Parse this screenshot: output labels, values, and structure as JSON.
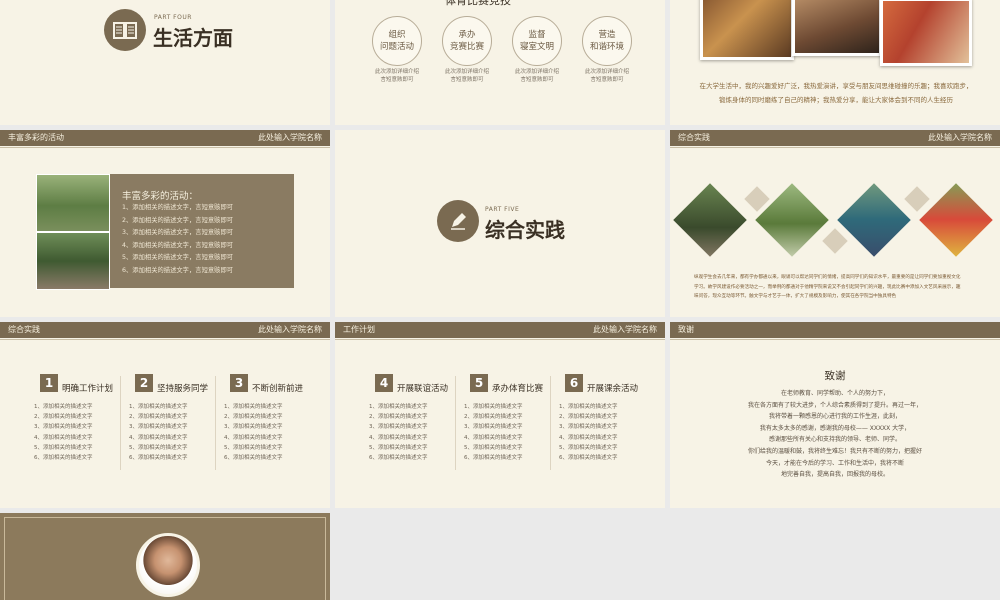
{
  "slide1": {
    "part": "PART FOUR",
    "title": "生活方面"
  },
  "slide2": {
    "top_title": "体育比赛竞技",
    "circles": [
      {
        "label": "组织\n问题活动",
        "desc": "此次添加详细介绍\n言短意赅即可"
      },
      {
        "label": "承办\n竞赛比赛",
        "desc": "此次添加详细介绍\n言短意赅即可"
      },
      {
        "label": "监督\n寝室文明",
        "desc": "此次添加详细介绍\n言短意赅即可"
      },
      {
        "label": "营造\n和谐环境",
        "desc": "此次添加详细介绍\n言短意赅即可"
      }
    ]
  },
  "slide3": {
    "para": "在大学生活中，我的兴趣爱好广泛，我热爱演讲，享受与朋友间思维碰撞的乐趣；我喜欢跑步，\n锻炼身体的同时磨练了自己的精神；我热爱分享，能让大家体会到不同的人生经历"
  },
  "slide4": {
    "header_left": "丰富多彩的活动",
    "header_right": "此处输入学院名称",
    "box_title": "丰富多彩的活动：",
    "items": [
      "1、添加相关的描述文字，言短意赅即可",
      "2、添加相关的描述文字，言短意赅即可",
      "3、添加相关的描述文字，言短意赅即可",
      "4、添加相关的描述文字，言短意赅即可",
      "5、添加相关的描述文字，言短意赅即可",
      "6、添加相关的描述文字，言短意赅即可"
    ]
  },
  "slide5": {
    "part": "PART FIVE",
    "title": "综合实践"
  },
  "slide6": {
    "header_left": "综合实践",
    "header_right": "此处输入学院名称",
    "para": "纵观学生会去几年来，都有学办都通以来，眼诵可以帮达同学们的情绪，提高同学们的知识水平，最重要的是让同学们要加重视文化\n学习。故学风建设作必要活动之一，而举例的都通对于他精学院来说又不会引起同学们的兴趣，现此比赛中添加入文艺风采展示，趣\n味问答，现众互动等环节。触文学与才艺于一体，扩大了规模及影响力，使其在各学院当中独具特色"
  },
  "columns_a": {
    "header_left": "综合实践",
    "header_right": "此处输入学院名称",
    "cols": [
      {
        "num": "1",
        "title": "明确工作计划",
        "items": [
          "1、添加相关的描述文字",
          "2、添加相关的描述文字",
          "3、添加相关的描述文字",
          "4、添加相关的描述文字",
          "5、添加相关的描述文字",
          "6、添加相关的描述文字"
        ]
      },
      {
        "num": "2",
        "title": "坚持服务同学",
        "items": [
          "1、添加相关的描述文字",
          "2、添加相关的描述文字",
          "3、添加相关的描述文字",
          "4、添加相关的描述文字",
          "5、添加相关的描述文字",
          "6、添加相关的描述文字"
        ]
      },
      {
        "num": "3",
        "title": "不断创新前进",
        "items": [
          "1、添加相关的描述文字",
          "2、添加相关的描述文字",
          "3、添加相关的描述文字",
          "4、添加相关的描述文字",
          "5、添加相关的描述文字",
          "6、添加相关的描述文字"
        ]
      }
    ]
  },
  "columns_b": {
    "header_left": "工作计划",
    "header_right": "此处输入学院名称",
    "cols": [
      {
        "num": "4",
        "title": "开展联谊活动",
        "items": [
          "1、添加相关的描述文字",
          "2、添加相关的描述文字",
          "3、添加相关的描述文字",
          "4、添加相关的描述文字",
          "5、添加相关的描述文字",
          "6、添加相关的描述文字"
        ]
      },
      {
        "num": "5",
        "title": "承办体育比赛",
        "items": [
          "1、添加相关的描述文字",
          "2、添加相关的描述文字",
          "3、添加相关的描述文字",
          "4、添加相关的描述文字",
          "5、添加相关的描述文字",
          "6、添加相关的描述文字"
        ]
      },
      {
        "num": "6",
        "title": "开展课余活动",
        "items": [
          "1、添加相关的描述文字",
          "2、添加相关的描述文字",
          "3、添加相关的描述文字",
          "4、添加相关的描述文字",
          "5、添加相关的描述文字",
          "6、添加相关的描述文字"
        ]
      }
    ]
  },
  "slide9": {
    "header_left": "致谢",
    "title": "致谢",
    "para": "在老师教育、同学帮助、个人的努力下，\n我在各方面有了较大进步，个人综合素质得到了提升。再过一年，\n我将带着一颗感恩的心进行我的工作生涯，此刻，\n我有太多太多的感谢，感谢我的母校—— XXXXX 大学，\n感谢那些所有关心和支持我的领导、老师、同学。\n你们给我的温暖和鼓，我将终生难忘！我只有不断的努力，把握好\n今天，才能在今后的学习、工作和生活中，我将不断\n地完善自我，提高自我，回报我的母校。"
  },
  "colors": {
    "accent": "#7a6a51",
    "bg": "#f7f3e6"
  }
}
